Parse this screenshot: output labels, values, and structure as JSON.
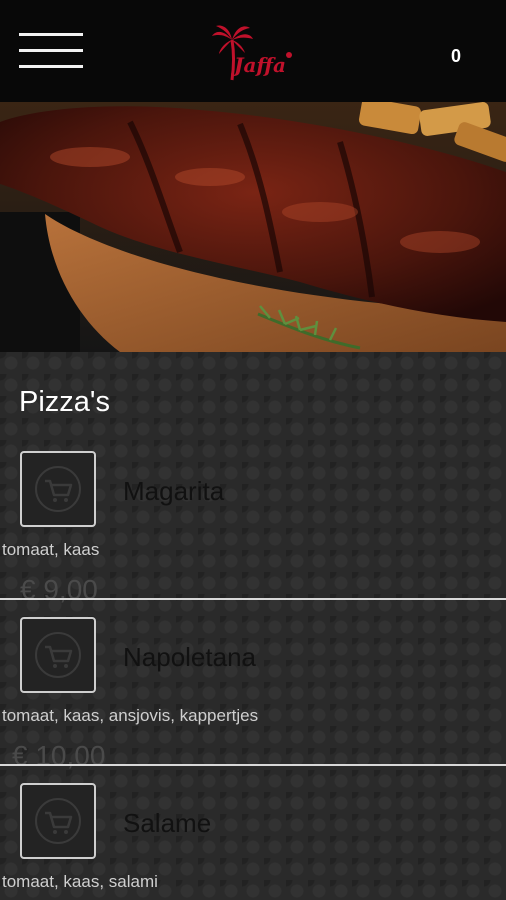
{
  "header": {
    "menu_icon": "hamburger-menu-icon",
    "logo_text": "Jaffa",
    "cart_count": "0"
  },
  "hero": {
    "alt": "grilled spare ribs on a wooden board"
  },
  "section": {
    "title": "Pizza's"
  },
  "items": [
    {
      "name": "Magarita",
      "description": "tomaat, kaas",
      "price": "€ 9,00",
      "icon": "cart-icon"
    },
    {
      "name": "Napoletana",
      "description": "tomaat, kaas, ansjovis, kappertjes",
      "price": "€ 10,00",
      "icon": "cart-icon"
    },
    {
      "name": "Salame",
      "description": "tomaat, kaas, salami",
      "price": "",
      "icon": "cart-icon"
    }
  ],
  "colors": {
    "topbar": "#080808",
    "brand_red": "#c0112b",
    "background": "#2a2a2a",
    "text_primary": "#ffffff",
    "item_name": "#111111"
  }
}
